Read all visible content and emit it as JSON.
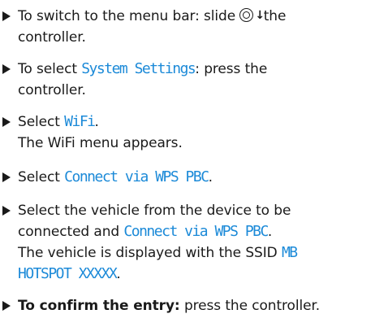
{
  "steps": [
    {
      "lines": [
        [
          {
            "t": "To switch to the menu bar: slide "
          },
          {
            "icon": "controller-slide-down-icon"
          },
          {
            "t": " the"
          }
        ],
        [
          {
            "t": "controller."
          }
        ]
      ]
    },
    {
      "lines": [
        [
          {
            "t": "To select "
          },
          {
            "t": "System Settings",
            "s": "mono"
          },
          {
            "t": ": press the"
          }
        ],
        [
          {
            "t": "controller."
          }
        ]
      ]
    },
    {
      "lines": [
        [
          {
            "t": "Select "
          },
          {
            "t": "WiFi",
            "s": "mono"
          },
          {
            "t": "."
          }
        ],
        [
          {
            "t": "The WiFi menu appears."
          }
        ]
      ]
    },
    {
      "lines": [
        [
          {
            "t": "Select "
          },
          {
            "t": "Connect via WPS PBC",
            "s": "mono"
          },
          {
            "t": "."
          }
        ]
      ]
    },
    {
      "lines": [
        [
          {
            "t": "Select the vehicle from the device to be"
          }
        ],
        [
          {
            "t": "connected and "
          },
          {
            "t": "Connect via WPS PBC",
            "s": "mono"
          },
          {
            "t": "."
          }
        ],
        [
          {
            "t": "The vehicle is displayed with the SSID "
          },
          {
            "t": "MB",
            "s": "mono"
          }
        ],
        [
          {
            "t": "HOTSPOT XXXXX",
            "s": "mono"
          },
          {
            "t": "."
          }
        ]
      ]
    },
    {
      "lines": [
        [
          {
            "t": "To confirm the entry:",
            "s": "bold"
          },
          {
            "t": " press the controller."
          }
        ]
      ]
    }
  ]
}
